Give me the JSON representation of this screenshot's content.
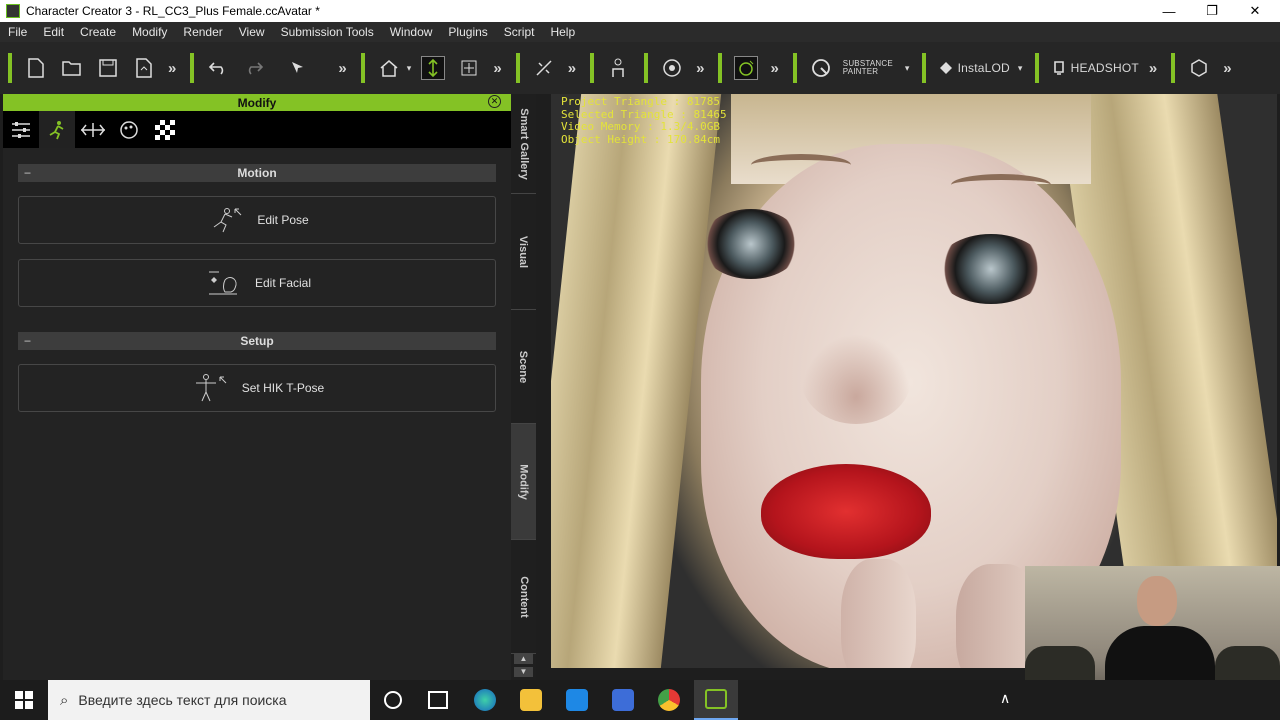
{
  "window": {
    "title": "Character Creator 3 - RL_CC3_Plus Female.ccAvatar *",
    "minimize": "—",
    "restore": "❐",
    "close": "✕"
  },
  "menu": [
    "File",
    "Edit",
    "Create",
    "Modify",
    "Render",
    "View",
    "Submission Tools",
    "Window",
    "Plugins",
    "Script",
    "Help"
  ],
  "toolbar": {
    "more": "»",
    "substance_top": "SUBSTANCE",
    "substance_bottom": "PAINTER",
    "instalod": "InstaLOD",
    "headshot": "HEADSHOT",
    "dropdown": "▾"
  },
  "panel": {
    "title": "Modify",
    "sections": [
      {
        "label": "Motion",
        "minus": "−"
      },
      {
        "label": "Setup",
        "minus": "−"
      }
    ],
    "buttons": {
      "edit_pose": "Edit Pose",
      "edit_facial": "Edit Facial",
      "set_hik": "Set HIK T-Pose"
    }
  },
  "side_tabs": [
    "Smart Gallery",
    "Visual",
    "Scene",
    "Modify",
    "Content"
  ],
  "viewport_stats": [
    "Project Triangle : 81785",
    "Selected Triangle : 81465",
    "Video Memory : 1.3/4.0GB",
    "Object Height : 170.84cm"
  ],
  "taskbar": {
    "search_placeholder": "Введите здесь текст для поиска",
    "chevron": "∧"
  },
  "colors": {
    "accent": "#84c225",
    "stats": "#e3e33a"
  }
}
